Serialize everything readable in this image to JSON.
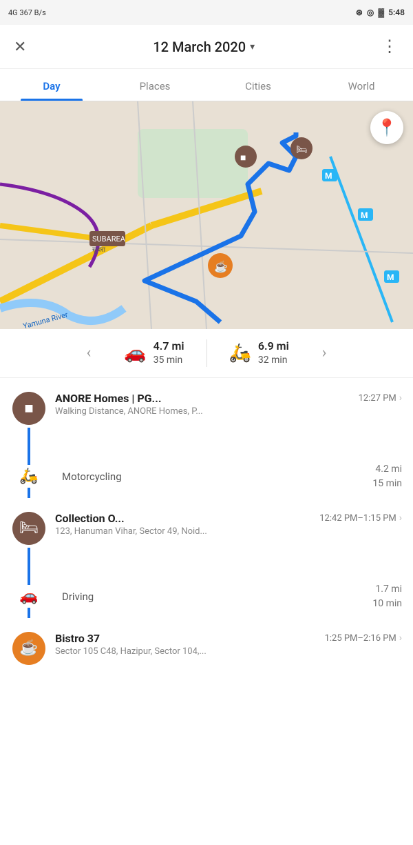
{
  "statusBar": {
    "left": "4G 367 B/s",
    "right": "5:48"
  },
  "header": {
    "closeIcon": "✕",
    "title": "12 March 2020",
    "dropdownArrow": "▾",
    "moreIcon": "⋮"
  },
  "tabs": [
    {
      "label": "Day",
      "active": true
    },
    {
      "label": "Places",
      "active": false
    },
    {
      "label": "Cities",
      "active": false
    },
    {
      "label": "World",
      "active": false
    }
  ],
  "transport": {
    "prevArrow": "‹",
    "nextArrow": "›",
    "items": [
      {
        "icon": "🚗",
        "distance": "4.7 mi",
        "duration": "35 min"
      },
      {
        "icon": "🛵",
        "distance": "6.9 mi",
        "duration": "32 min"
      }
    ]
  },
  "timeline": [
    {
      "type": "place",
      "iconType": "stop",
      "iconEmoji": "■",
      "iconBg": "#795548",
      "name": "ANORE Homes | PG...",
      "time": "12:27 PM",
      "address": "Walking Distance, ANORE Homes, P...",
      "hasChevron": true
    },
    {
      "type": "segment",
      "icon": "🛵",
      "label": "Motorcycling",
      "distance": "4.2 mi",
      "duration": "15 min"
    },
    {
      "type": "place",
      "iconType": "hotel",
      "iconEmoji": "🛏",
      "iconBg": "#795548",
      "name": "Collection O...",
      "time": "12:42 PM–1:15 PM",
      "address": "123, Hanuman Vihar, Sector 49, Noid...",
      "hasChevron": true
    },
    {
      "type": "segment",
      "icon": "🚗",
      "label": "Driving",
      "distance": "1.7 mi",
      "duration": "10 min"
    },
    {
      "type": "place",
      "iconType": "coffee",
      "iconEmoji": "☕",
      "iconBg": "#e67e22",
      "name": "Bistro 37",
      "time": "1:25 PM–2:16 PM",
      "address": "Sector 105 C48, Hazipur, Sector 104,...",
      "hasChevron": true
    }
  ],
  "locationIcon": "📍"
}
